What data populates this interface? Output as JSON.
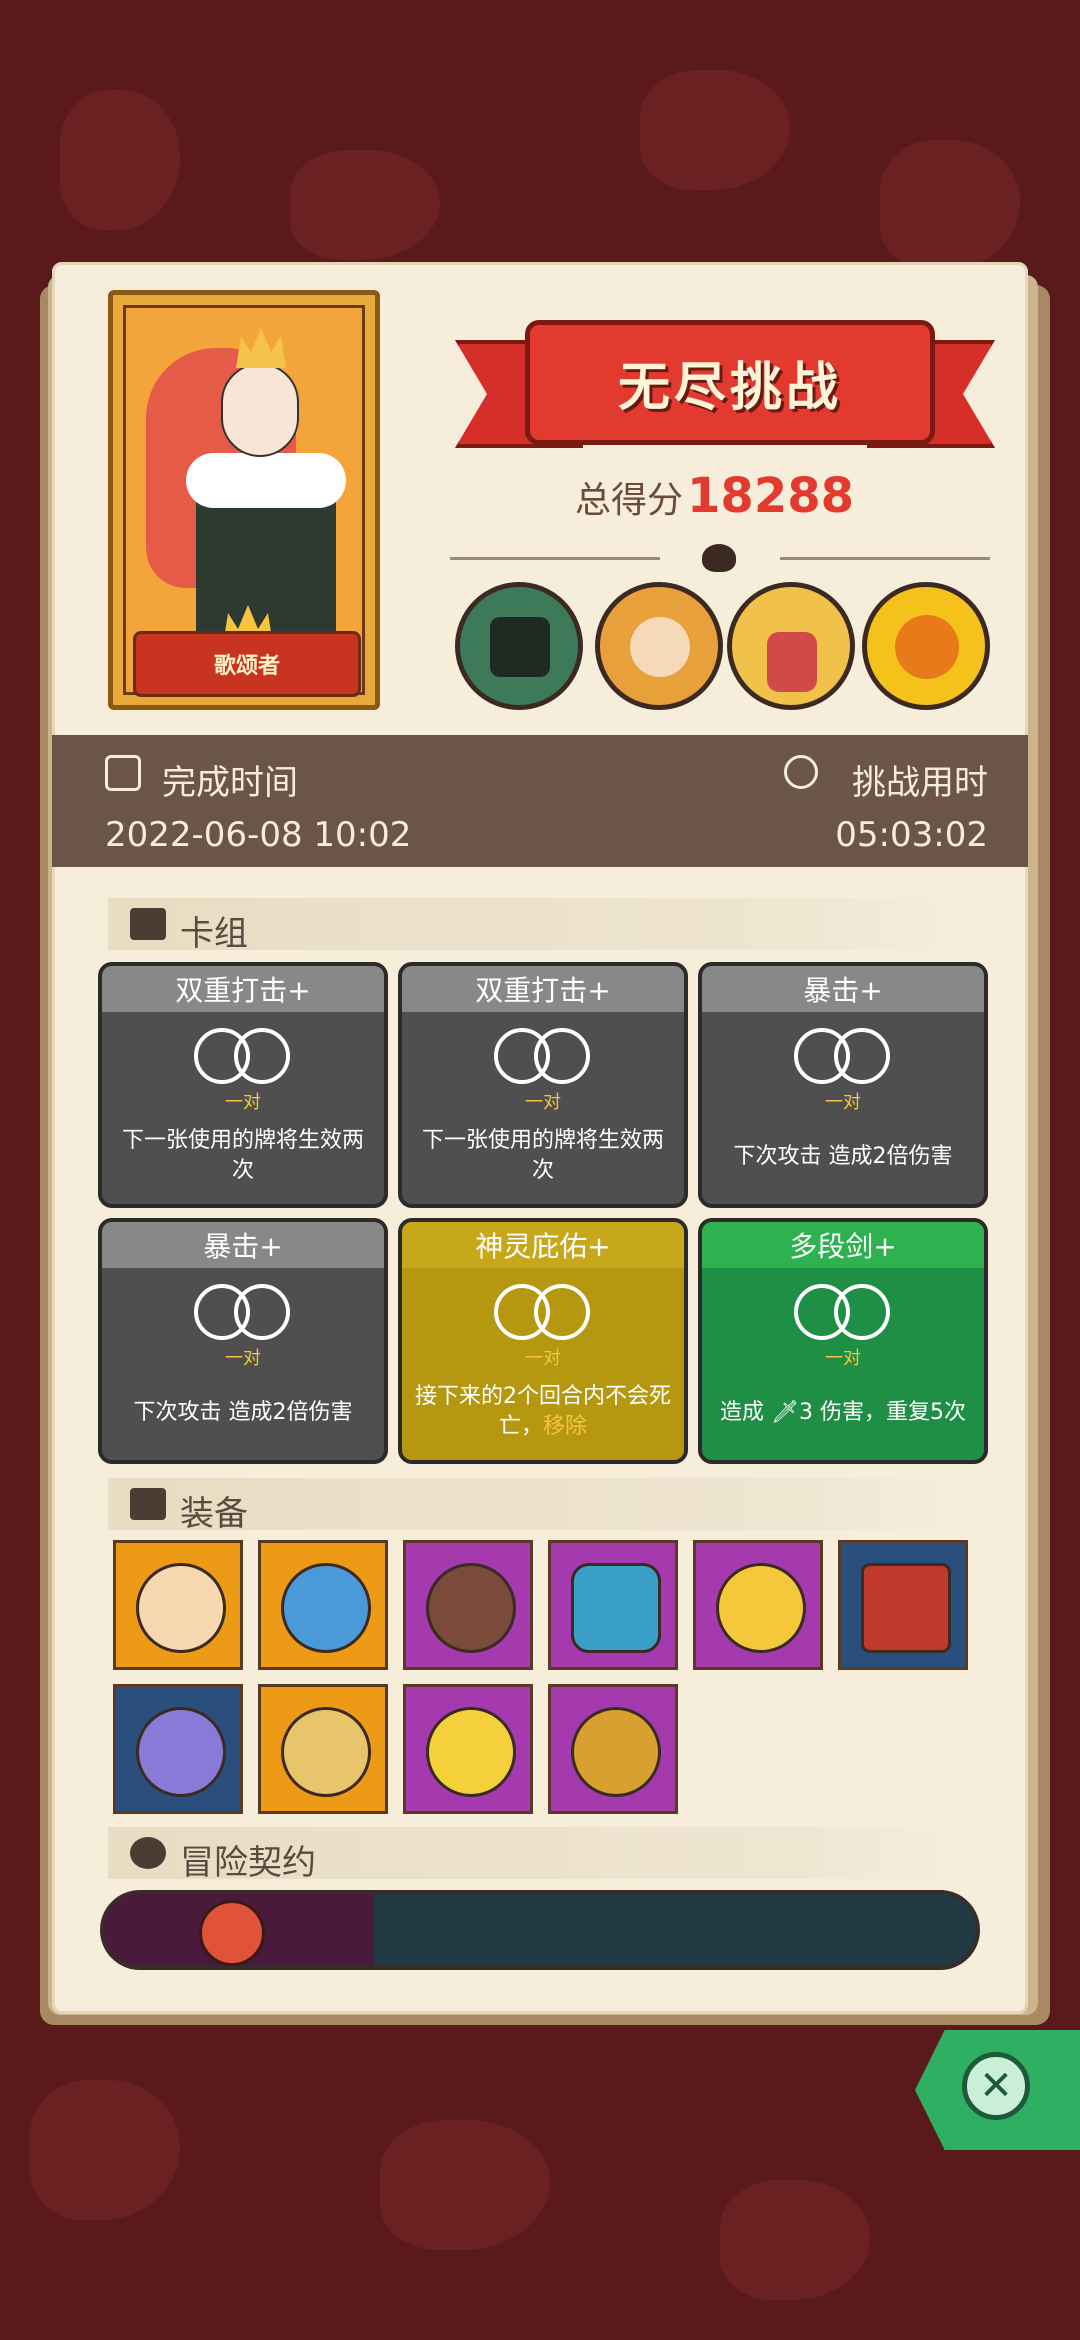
{
  "hero": {
    "name": "歌颂者"
  },
  "banner": {
    "title": "无尽挑战"
  },
  "score": {
    "label": "总得分",
    "value": "18288"
  },
  "times": {
    "complete_label": "完成时间",
    "complete_value": "2022-06-08 10:02",
    "duration_label": "挑战用时",
    "duration_value": "05:03:02"
  },
  "deck": {
    "title": "卡组",
    "cards": [
      {
        "name": "双重打击+",
        "tag": "一对",
        "desc": "下一张使用的牌将生效两次"
      },
      {
        "name": "双重打击+",
        "tag": "一对",
        "desc": "下一张使用的牌将生效两次"
      },
      {
        "name": "暴击+",
        "tag": "一对",
        "desc": "下次攻击 造成2倍伤害"
      },
      {
        "name": "暴击+",
        "tag": "一对",
        "desc": "下次攻击 造成2倍伤害"
      },
      {
        "name": "神灵庇佑+",
        "tag": "一对",
        "desc": "接下来的2个回合内不会死亡，",
        "desc_hl": "移除"
      },
      {
        "name": "多段剑+",
        "tag": "一对",
        "desc": "造成 🗡3 伤害，重复5次"
      }
    ]
  },
  "equipment": {
    "title": "装备",
    "items": [
      {
        "icon": "ring-shield-icon",
        "rarity": "orange"
      },
      {
        "icon": "blue-cloud-icon",
        "rarity": "orange"
      },
      {
        "icon": "button-icon",
        "rarity": "purple"
      },
      {
        "icon": "blue-shield-icon",
        "rarity": "purple"
      },
      {
        "icon": "moon-star-icon",
        "rarity": "purple"
      },
      {
        "icon": "red-book-icon",
        "rarity": "blue"
      },
      {
        "icon": "star-crystal-icon",
        "rarity": "blue"
      },
      {
        "icon": "lion-ring-icon",
        "rarity": "orange"
      },
      {
        "icon": "sun-chalice-icon",
        "rarity": "purple"
      },
      {
        "icon": "blood-ring-icon",
        "rarity": "purple"
      }
    ]
  },
  "contract": {
    "title": "冒险契约"
  },
  "colors": {
    "accent": "#e23a2f",
    "band": "#6b5548",
    "paper": "#f6eedb"
  }
}
